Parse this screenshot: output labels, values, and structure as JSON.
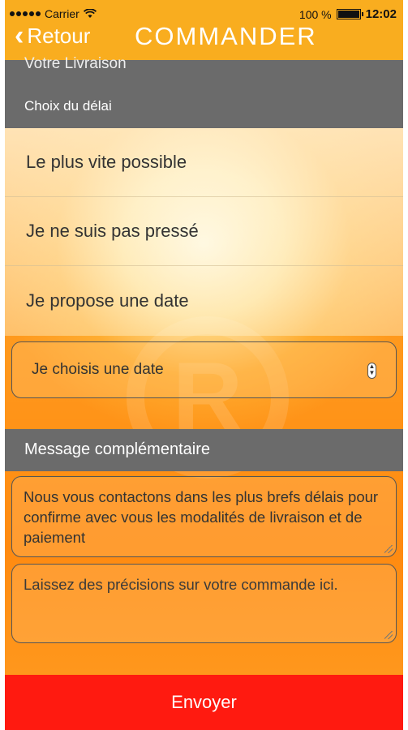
{
  "status_bar": {
    "carrier": "Carrier",
    "battery": "100 %",
    "time": "12:02"
  },
  "nav": {
    "back_label": "Retour",
    "title": "COMMANDER"
  },
  "delivery": {
    "section_title": "Votre Livraison",
    "subtitle": "Choix du délai",
    "options": [
      {
        "label": "Le plus vite possible"
      },
      {
        "label": "Je ne suis pas pressé"
      },
      {
        "label": "Je propose une date"
      }
    ],
    "date_select": {
      "value": "Je choisis une date"
    }
  },
  "message": {
    "section_title": "Message complémentaire",
    "info_text": "Nous vous contactons dans les plus brefs délais pour confirme avec vous les modalités de livraison et de paiement",
    "comment_placeholder": "Laissez des précisions sur votre commande ici."
  },
  "actions": {
    "send_label": "Envoyer"
  },
  "colors": {
    "nav_bar": "#f9ad1f",
    "section_header": "#6b6b6b",
    "send_button": "#ff1a10"
  }
}
